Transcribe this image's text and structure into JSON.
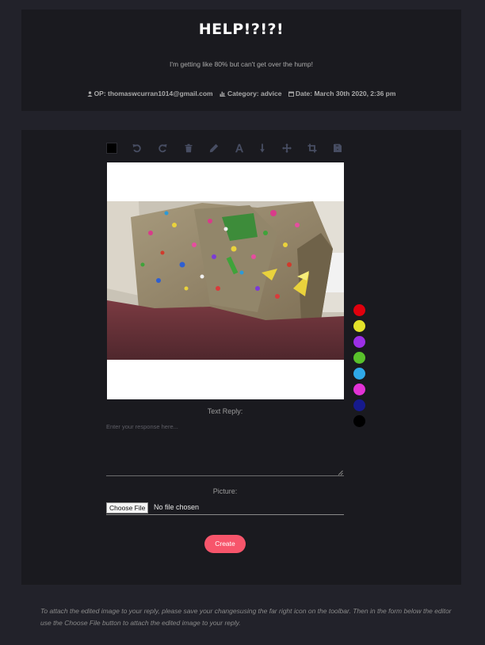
{
  "post": {
    "title": "HELP!?!?!",
    "body": "I'm getting like 80% but can't get over the hump!",
    "op": "OP: thomaswcurran1014@gmail.com",
    "category": "Category: advice",
    "date": "Date: March 30th 2020, 2:36 pm"
  },
  "editor": {
    "current_color": "#000000",
    "toolbar_icons": [
      "undo-icon",
      "redo-icon",
      "trash-icon",
      "pencil-icon",
      "text-icon",
      "arrow-icon",
      "move-icon",
      "crop-icon",
      "save-icon"
    ],
    "palette": [
      "#e0000d",
      "#e3e22a",
      "#9c2fe6",
      "#59c12b",
      "#2fa9e8",
      "#e332d6",
      "#161a8c",
      "#000000"
    ]
  },
  "reply": {
    "text_label": "Text Reply:",
    "text_placeholder": "Enter your response here...",
    "picture_label": "Picture:",
    "choose_file_label": "Choose File",
    "file_status": "No file chosen",
    "create_label": "Create"
  },
  "footnote": "To attach the edited image to your reply, please save your changesusing the far right icon on the toolbar. Then in the form below the editor use the Choose File button to attach the edited image to your reply."
}
